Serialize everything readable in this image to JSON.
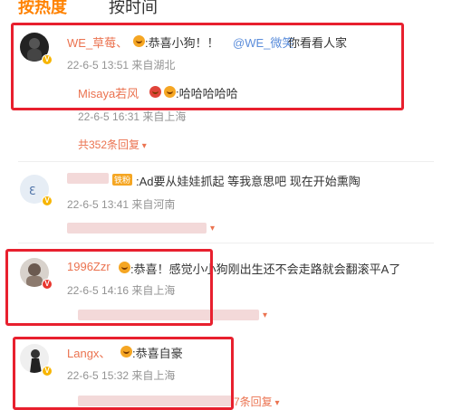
{
  "tabs": {
    "hot": "按热度",
    "time": "按时间"
  },
  "comments": [
    {
      "name": "WE_草莓、",
      "text_prefix": ":恭喜小狗！！",
      "mention": "@WE_微笑",
      "text_suffix": " 你看看人家",
      "meta": "22-6-5 13:51  来自湖北",
      "reply": {
        "name": "Misaya若风",
        "text": ":哈哈哈哈哈",
        "meta": "22-6-5 16:31  来自上海"
      },
      "more": "共352条回复"
    },
    {
      "name": "",
      "text": ":Ad要从娃娃抓起 等我意思吧 现在开始熏陶",
      "badge": "铁粉",
      "meta": "22-6-5 13:41  来自河南"
    },
    {
      "name": "1996Zzr",
      "text": ":恭喜！感觉小小狗刚出生还不会走路就会翻滚平A了",
      "meta": "22-6-5 14:16  来自上海"
    },
    {
      "name": "Langx、",
      "text": ":恭喜自豪",
      "meta": "22-6-5 15:32  来自上海",
      "more": "7条回复"
    }
  ],
  "colors": {
    "accent": "#ff8200",
    "highlight": "#e8202e",
    "name": "#eb7350"
  }
}
